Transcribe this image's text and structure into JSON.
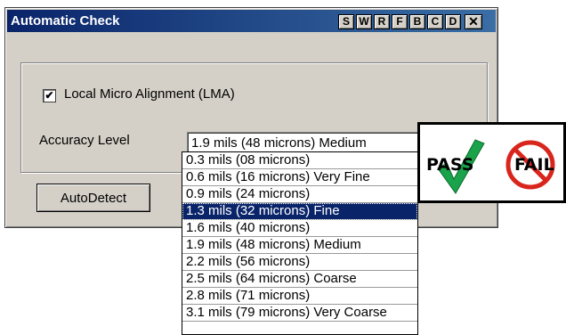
{
  "window": {
    "title": "Automatic Check",
    "title_buttons": [
      "S",
      "W",
      "R",
      "F",
      "B",
      "C",
      "D"
    ],
    "close_label": "✕"
  },
  "lma": {
    "label": "Local Micro Alignment (LMA)",
    "checked": true,
    "check_glyph": "✔"
  },
  "accuracy": {
    "label": "Accuracy Level",
    "selected": "1.9 mils (48 microns) Medium",
    "options": [
      "0.3 mils (08 microns)",
      "0.6 mils (16 microns) Very Fine",
      "0.9 mils (24 microns)",
      "1.3 mils (32 microns) Fine",
      "1.6 mils (40 microns)",
      "1.9 mils (48 microns) Medium",
      "2.2 mils (56 microns)",
      "2.5 mils (64 microns) Coarse",
      "2.8 mils (71 microns)",
      "3.1 mils (79 microns) Very Coarse"
    ],
    "highlighted_index": 3
  },
  "autodetect_label": "AutoDetect",
  "passfail": {
    "pass": "PASS",
    "fail": "FAIL"
  },
  "colors": {
    "title_bg": "#0a246a",
    "highlight": "#0a246a",
    "check_green": "#1aa34a",
    "no_red": "#d9261c"
  }
}
